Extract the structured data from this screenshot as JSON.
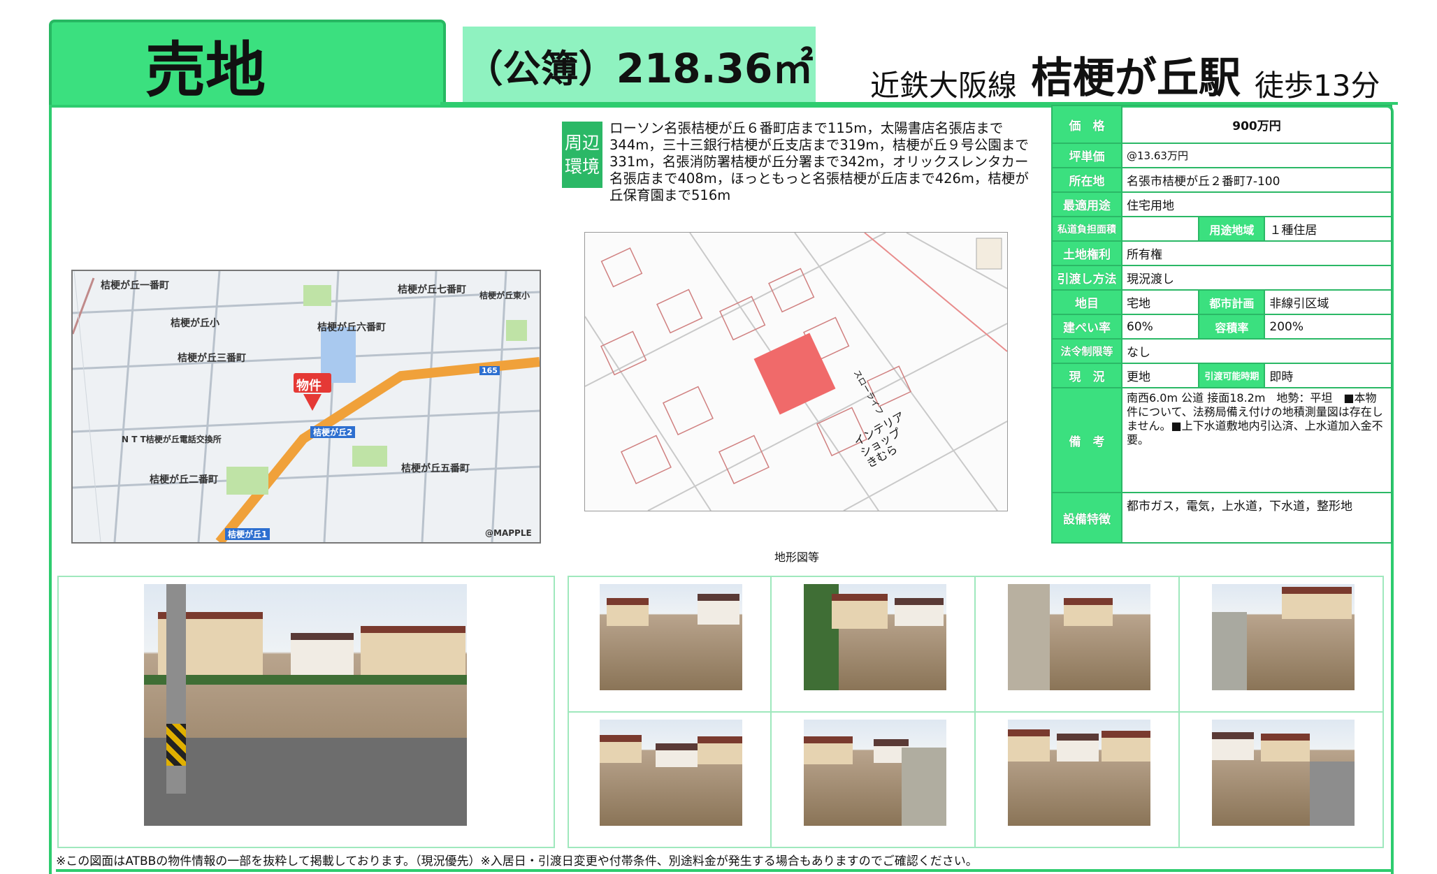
{
  "header": {
    "title": "売地",
    "area_label": "（公簿）",
    "area_value": "218.36㎡",
    "line": "近鉄大阪線",
    "station": "桔梗が丘駅",
    "walk": "徒歩13分"
  },
  "environment": {
    "badge": "周辺\n環境",
    "text": "ローソン名張桔梗が丘６番町店まで115m，太陽書店名張店まで344m，三十三銀行桔梗が丘支店まで319m，桔梗が丘９号公園まで331m，名張消防署桔梗が丘分署まで342m，オリックスレンタカー名張店まで408m，ほっともっと名張桔梗が丘店まで426m，桔梗が丘保育園まで516m"
  },
  "map": {
    "labels": [
      "桔梗が丘一番町",
      "桔梗が丘七番町",
      "桔梗が丘東小",
      "桔梗が丘小",
      "桔梗が丘六番町",
      "桔梗が丘三番町",
      "物件",
      "N T T桔梗が丘電話交換所",
      "桔梗が丘二番町",
      "桔梗が丘五番町",
      "桔梗が丘2",
      "桔梗が丘1",
      "@MAPPLE",
      "165"
    ]
  },
  "terrain": {
    "caption": "地形図等",
    "labels": [
      "インテリア\nショップ\nきむら",
      "スローライフ"
    ]
  },
  "info": {
    "price_label": "価　格",
    "price": "900万円",
    "unit_price_label": "坪単価",
    "unit_price": "@13.63万円",
    "location_label": "所在地",
    "location": "名張市桔梗が丘２番町7-100",
    "best_use_label": "最適用途",
    "best_use": "住宅用地",
    "private_road_label": "私道負担面積",
    "private_road": "",
    "zoning_label": "用途地域",
    "zoning": "１種住居",
    "land_right_label": "土地権利",
    "land_right": "所有権",
    "handover_method_label": "引渡し方法",
    "handover_method": "現況渡し",
    "land_category_label": "地目",
    "land_category": "宅地",
    "city_plan_label": "都市計画",
    "city_plan": "非線引区域",
    "coverage_label": "建ぺい率",
    "coverage": "60%",
    "floor_ratio_label": "容積率",
    "floor_ratio": "200%",
    "legal_label": "法令制限等",
    "legal": "なし",
    "status_label": "現　況",
    "status": "更地",
    "handover_time_label": "引渡可能時期",
    "handover_time": "即時",
    "remarks_label": "備　考",
    "remarks": "南西6.0m 公道 接面18.2m　地勢：平坦　■本物件について、法務局備え付けの地積測量図は存在しません。■上下水道敷地内引込済、上水道加入金不要。",
    "facilities_label": "設備特徴",
    "facilities": "都市ガス，電気，上水道，下水道，整形地"
  },
  "footer": {
    "note": "※この図面はATBBの物件情報の一部を抜粋して掲載しております。（現況優先）※入居日・引渡日変更や付帯条件、別途料金が発生する場合もありますのでご確認ください。"
  },
  "colors": {
    "accent_green": "#3be07f",
    "border_green": "#2ecc6f",
    "light_green": "#8ff2c0",
    "plot_red": "#f06a6a"
  }
}
